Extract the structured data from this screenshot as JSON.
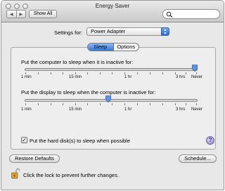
{
  "window": {
    "title": "Energy Saver"
  },
  "toolbar": {
    "show_all_label": "Show All",
    "search_placeholder": "",
    "back_glyph": "◀",
    "forward_glyph": "▶"
  },
  "settings": {
    "label": "Settings for:",
    "selected": "Power Adapter"
  },
  "tabs": [
    {
      "label": "Sleep",
      "active": true
    },
    {
      "label": "Options",
      "active": false
    }
  ],
  "sleep": {
    "computer": {
      "label": "Put the computer to sleep when it is inactive for:",
      "value": "Never",
      "ticks": [
        "1 min",
        "15 min",
        "1 hr",
        "3 hrs",
        "Never"
      ]
    },
    "display": {
      "label": "Put the display to sleep when the computer is inactive for:",
      "value": "1 hr",
      "ticks": [
        "1 min",
        "15 min",
        "1 hr",
        "3 hrs",
        "Never"
      ]
    },
    "hard_disk": {
      "label": "Put the hard disk(s) to sleep when possible",
      "checked": true
    }
  },
  "buttons": {
    "restore_label": "Restore Defaults",
    "schedule_label": "Schedule..."
  },
  "lock": {
    "text": "Click the lock to prevent further changes."
  },
  "colors": {
    "accent": "#3478dc",
    "help": "#8f7fc4",
    "lock": "#d8a23a"
  }
}
